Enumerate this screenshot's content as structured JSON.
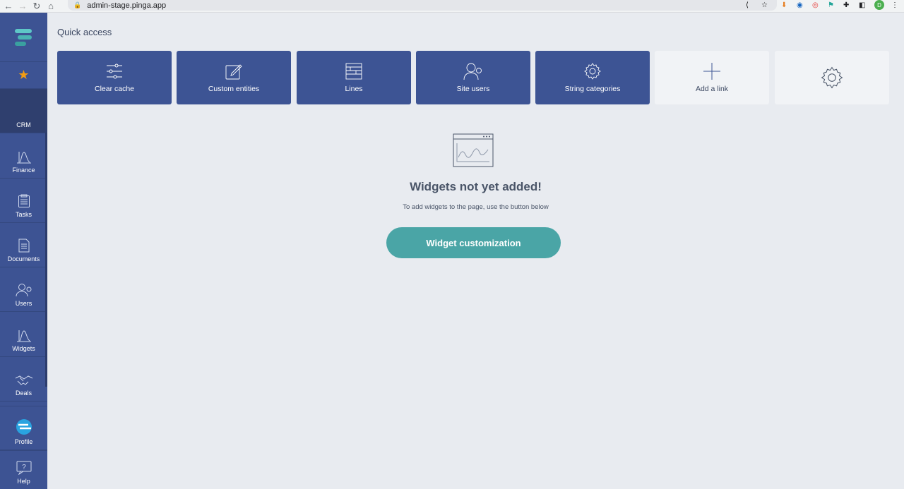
{
  "browser": {
    "url": "admin-stage.pinga.app",
    "profile_initial": "D"
  },
  "sidebar": {
    "items": [
      {
        "label": "CRM"
      },
      {
        "label": "Finance"
      },
      {
        "label": "Tasks"
      },
      {
        "label": "Documents"
      },
      {
        "label": "Users"
      },
      {
        "label": "Widgets"
      },
      {
        "label": "Deals"
      }
    ],
    "bottom": [
      {
        "label": "Profile"
      },
      {
        "label": "Help"
      }
    ],
    "help_glyph": "?"
  },
  "main": {
    "quick_access_title": "Quick access",
    "tiles": [
      {
        "label": "Clear cache",
        "icon": "sliders-icon"
      },
      {
        "label": "Custom entities",
        "icon": "edit-icon"
      },
      {
        "label": "Lines",
        "icon": "lines-icon"
      },
      {
        "label": "Site users",
        "icon": "users-icon"
      },
      {
        "label": "String categories",
        "icon": "gear-icon"
      },
      {
        "label": "Add a link",
        "icon": "plus-icon"
      },
      {
        "label": "",
        "icon": "gear-icon"
      }
    ],
    "empty_title": "Widgets not yet added!",
    "empty_subtitle": "To add widgets to the page, use the button below",
    "cta_label": "Widget customization"
  },
  "colors": {
    "sidebar": "#3d5393",
    "tile": "#3d5494",
    "accent": "#4aa5a6",
    "star": "#f39c12"
  }
}
